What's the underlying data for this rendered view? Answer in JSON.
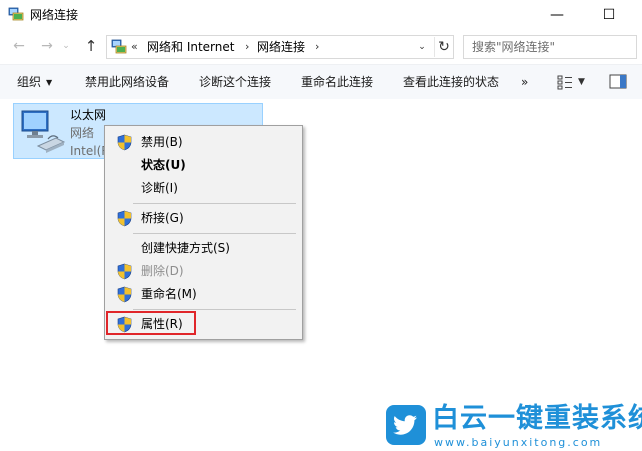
{
  "window": {
    "title": "网络连接",
    "minimize_glyph": "—",
    "maximize_glyph": "☐"
  },
  "address_bar": {
    "overflow": "«",
    "segments": [
      "网络和 Internet",
      "网络连接"
    ],
    "separator": "›",
    "dropdown_glyph": "⌄",
    "refresh_glyph": "↻"
  },
  "search": {
    "placeholder": "搜索\"网络连接\""
  },
  "nav": {
    "back_glyph": "←",
    "forward_glyph": "→",
    "recent_glyph": "⌄",
    "up_glyph": "↑"
  },
  "command_bar": {
    "organize": "组织",
    "organize_caret": "▼",
    "disable_device": "禁用此网络设备",
    "diagnose": "诊断这个连接",
    "rename": "重命名此连接",
    "view_status": "查看此连接的状态",
    "more": "»",
    "view_caret": "▼"
  },
  "connection": {
    "name": "以太网",
    "status": "网络",
    "device": "Intel(R"
  },
  "context_menu": {
    "items": [
      {
        "label": "禁用(B)",
        "shield": true,
        "style": "normal"
      },
      {
        "label": "状态(U)",
        "shield": false,
        "style": "bold"
      },
      {
        "label": "诊断(I)",
        "shield": false,
        "style": "normal"
      },
      {
        "label": "桥接(G)",
        "shield": true,
        "style": "normal"
      },
      {
        "label": "创建快捷方式(S)",
        "shield": false,
        "style": "normal"
      },
      {
        "label": "删除(D)",
        "shield": true,
        "style": "disabled"
      },
      {
        "label": "重命名(M)",
        "shield": true,
        "style": "normal"
      },
      {
        "label": "属性(R)",
        "shield": true,
        "style": "normal"
      }
    ],
    "highlighted_item": "属性(R)",
    "highlight_color": "#e0262a"
  },
  "watermark": {
    "title": "白云一键重装系统",
    "url": "www.baiyunxitong.com",
    "color": "#1f90d8"
  },
  "colors": {
    "selection_bg": "#cce8ff",
    "selection_border": "#99d1ff",
    "menu_bg": "#f2f2f2",
    "command_bar_bg": "#f6f8fb"
  }
}
